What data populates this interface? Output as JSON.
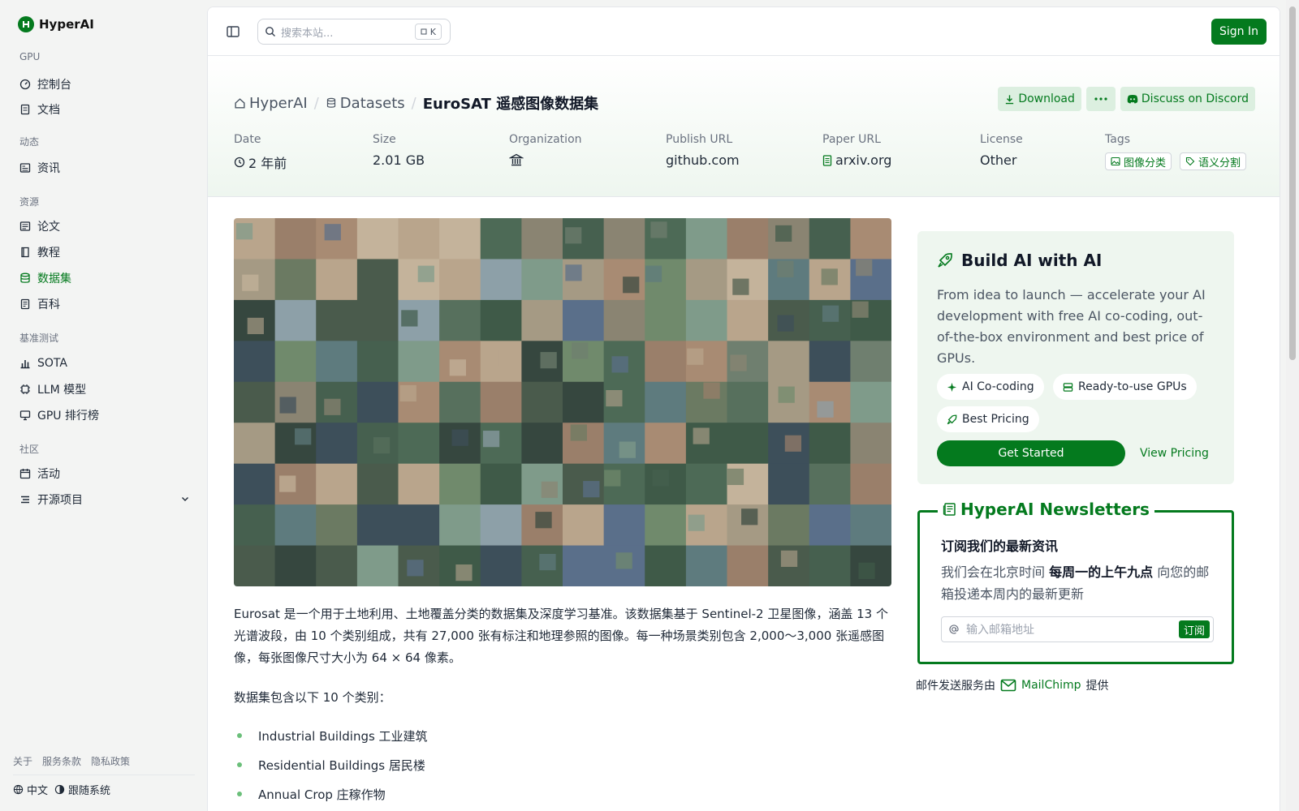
{
  "app": {
    "name": "HyperAI"
  },
  "sidebar": {
    "sections": [
      {
        "label": "GPU",
        "items": [
          {
            "label": "控制台",
            "icon": "gauge-icon"
          },
          {
            "label": "文档",
            "icon": "doc-icon"
          }
        ]
      },
      {
        "label": "动态",
        "items": [
          {
            "label": "资讯",
            "icon": "news-icon"
          }
        ]
      },
      {
        "label": "资源",
        "items": [
          {
            "label": "论文",
            "icon": "paper-icon"
          },
          {
            "label": "教程",
            "icon": "book-icon"
          },
          {
            "label": "数据集",
            "icon": "database-icon",
            "active": true
          },
          {
            "label": "百科",
            "icon": "wiki-icon"
          }
        ]
      },
      {
        "label": "基准测试",
        "items": [
          {
            "label": "SOTA",
            "icon": "chart-icon"
          },
          {
            "label": "LLM 模型",
            "icon": "chip-icon"
          },
          {
            "label": "GPU 排行榜",
            "icon": "monitor-icon"
          }
        ]
      },
      {
        "label": "社区",
        "items": [
          {
            "label": "活动",
            "icon": "calendar-icon"
          },
          {
            "label": "开源项目",
            "icon": "list-icon"
          }
        ]
      }
    ],
    "footer_links": [
      "关于",
      "服务条款",
      "隐私政策"
    ],
    "language": "中文",
    "theme": "跟随系统"
  },
  "topbar": {
    "search_placeholder": "搜索本站...",
    "shortcut_key": "K",
    "sign_in": "Sign In"
  },
  "breadcrumb": {
    "home": "HyperAI",
    "section": "Datasets",
    "current": "EuroSAT 遥感图像数据集"
  },
  "actions": {
    "download": "Download",
    "more": "···",
    "discord": "Discuss on Discord"
  },
  "meta": {
    "date_label": "Date",
    "date": "2 年前",
    "size_label": "Size",
    "size": "2.01 GB",
    "org_label": "Organization",
    "publish_label": "Publish URL",
    "publish": "github.com",
    "paper_label": "Paper URL",
    "paper": "arxiv.org",
    "license_label": "License",
    "license": "Other",
    "tags_label": "Tags",
    "tags": [
      "图像分类",
      "语义分割"
    ]
  },
  "content": {
    "description": "Eurosat 是一个用于土地利用、土地覆盖分类的数据集及深度学习基准。该数据集基于 Sentinel-2 卫星图像，涵盖 13 个光谱波段，由 10 个类别组成，共有 27,000 张有标注和地理参照的图像。每一种场景类别包含 2,000～3,000 张遥感图像，每张图像尺寸大小为 64 × 64 像素。",
    "categories_intro": "数据集包含以下 10 个类别：",
    "categories": [
      "Industrial Buildings 工业建筑",
      "Residential Buildings 居民楼",
      "Annual Crop 庄稼作物"
    ]
  },
  "promo": {
    "title": "Build AI with AI",
    "text": "From idea to launch — accelerate your AI development with free AI co-coding, out-of-the-box environment and best price of GPUs.",
    "features": [
      "AI Co-coding",
      "Ready-to-use GPUs",
      "Best Pricing"
    ],
    "cta": "Get Started",
    "pricing": "View Pricing"
  },
  "newsletter": {
    "legend": "HyperAI Newsletters",
    "title": "订阅我们的最新资讯",
    "text_before": "我们会在北京时间",
    "text_bold": "每周一的上午九点",
    "text_after": "向您的邮箱投递本周内的最新更新",
    "placeholder": "输入邮箱地址",
    "subscribe": "订阅",
    "provider_prefix": "邮件发送服务由",
    "provider": "MailChimp",
    "provider_suffix": "提供"
  },
  "colors": {
    "accent": "#047a1e",
    "accent_light": "#dcefe0",
    "panel_bg": "#eef6ef"
  }
}
